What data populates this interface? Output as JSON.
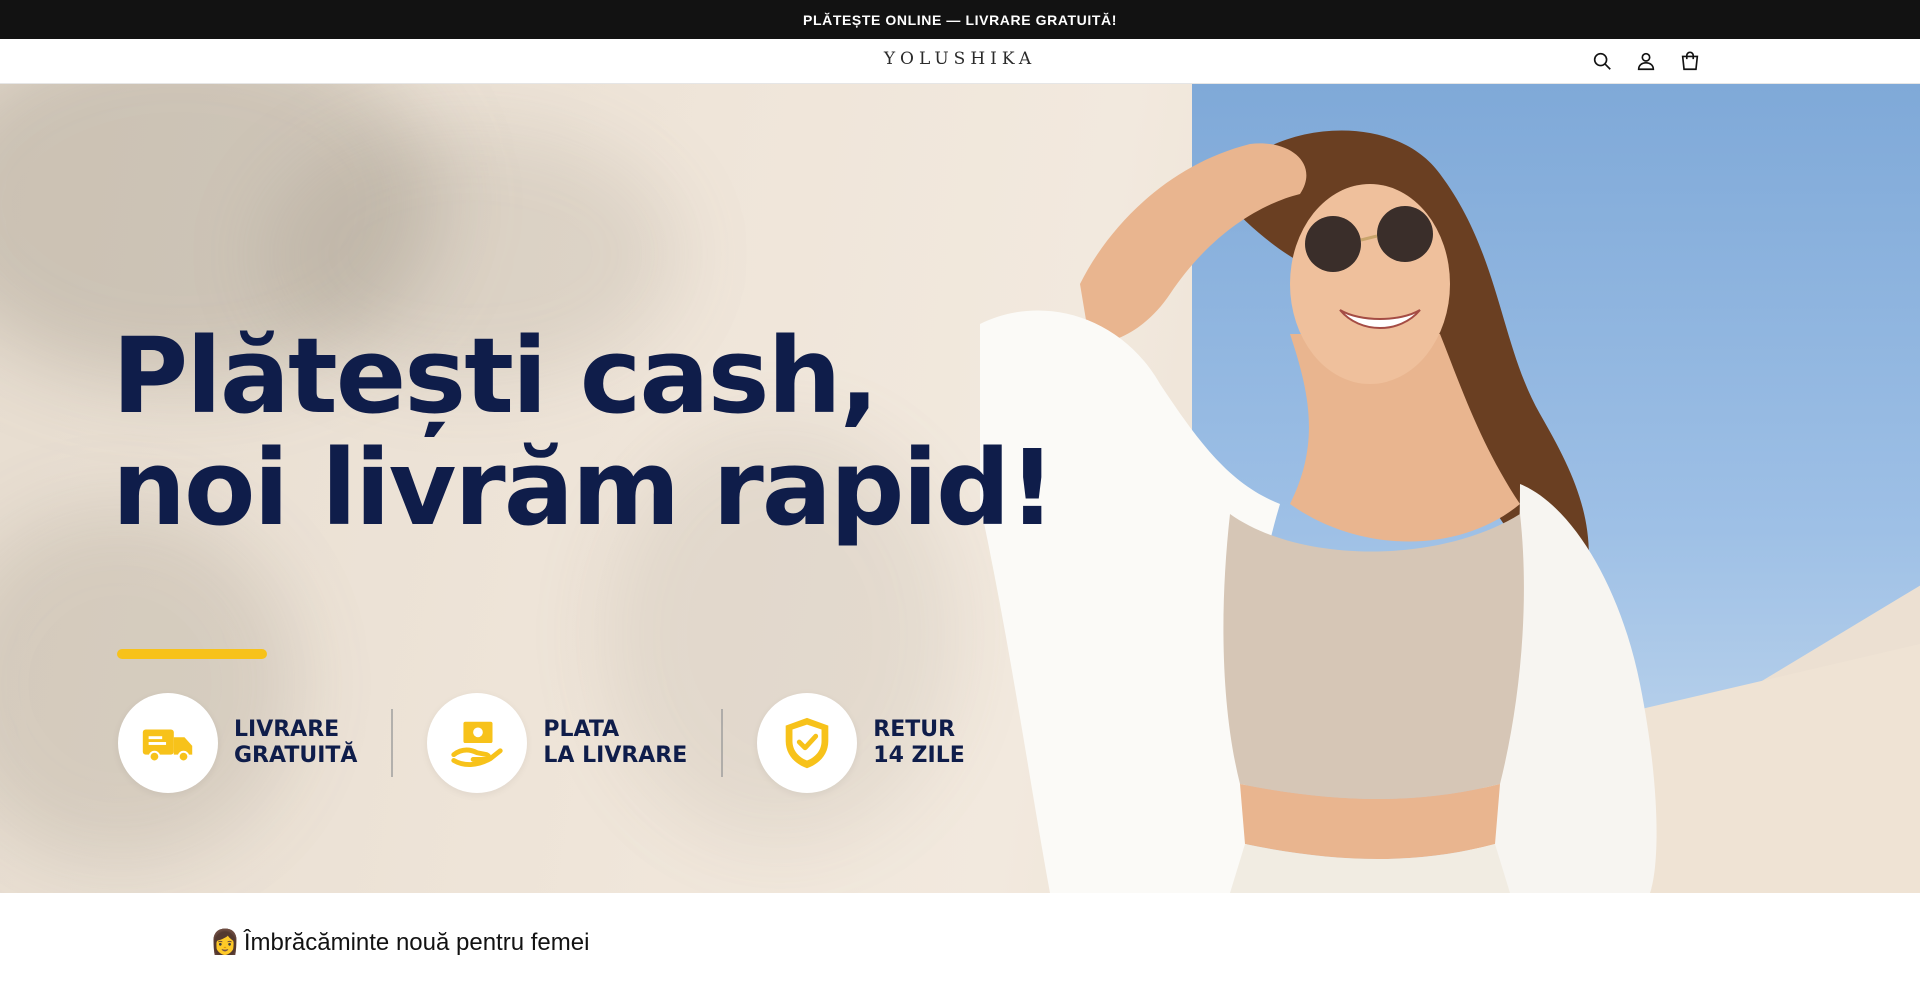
{
  "announcement": {
    "text": "PLĂTEȘTE ONLINE — LIVRARE GRATUITĂ!"
  },
  "header": {
    "logo": "YOLUSHIKA",
    "icons": [
      "search-icon",
      "account-icon",
      "cart-icon"
    ]
  },
  "hero": {
    "headline_line1": "Plătești cash,",
    "headline_line2": "noi livrăm rapid!",
    "accent_color": "#f7c21a",
    "text_color": "#0f1d4a",
    "features": [
      {
        "icon": "delivery-truck-icon",
        "label": "LIVRARE\nGRATUITĂ"
      },
      {
        "icon": "cash-payment-icon",
        "label": "PLATA\nLA LIVRARE"
      },
      {
        "icon": "shield-check-icon",
        "label": "RETUR\n14 ZILE"
      }
    ]
  },
  "collection": {
    "emoji": "👩",
    "title": "Îmbrăcăminte nouă pentru femei"
  }
}
